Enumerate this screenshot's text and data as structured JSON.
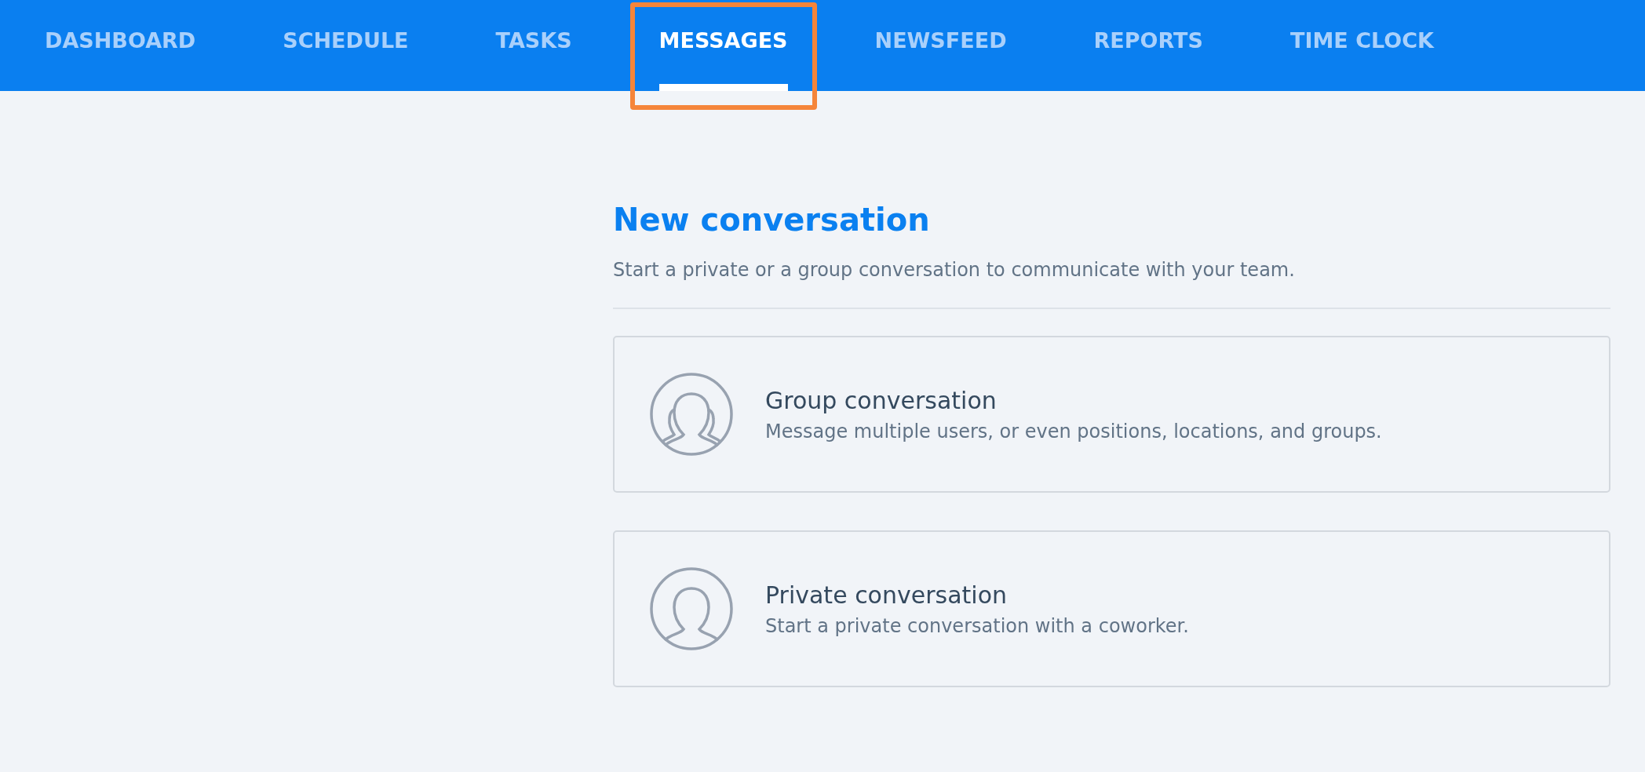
{
  "nav": {
    "tabs": [
      {
        "label": "DASHBOARD",
        "selected": false,
        "highlighted": false
      },
      {
        "label": "SCHEDULE",
        "selected": false,
        "highlighted": false
      },
      {
        "label": "TASKS",
        "selected": false,
        "highlighted": false
      },
      {
        "label": "MESSAGES",
        "selected": true,
        "highlighted": true
      },
      {
        "label": "NEWSFEED",
        "selected": false,
        "highlighted": false
      },
      {
        "label": "REPORTS",
        "selected": false,
        "highlighted": false
      },
      {
        "label": "TIME CLOCK",
        "selected": false,
        "highlighted": false
      }
    ]
  },
  "page": {
    "title": "New conversation",
    "subtitle": "Start a private or a group conversation to communicate with your team.",
    "options": [
      {
        "kind": "group",
        "title": "Group conversation",
        "description": "Message multiple users, or even positions, locations, and groups."
      },
      {
        "kind": "private",
        "title": "Private conversation",
        "description": "Start a private conversation with a coworker."
      }
    ]
  }
}
